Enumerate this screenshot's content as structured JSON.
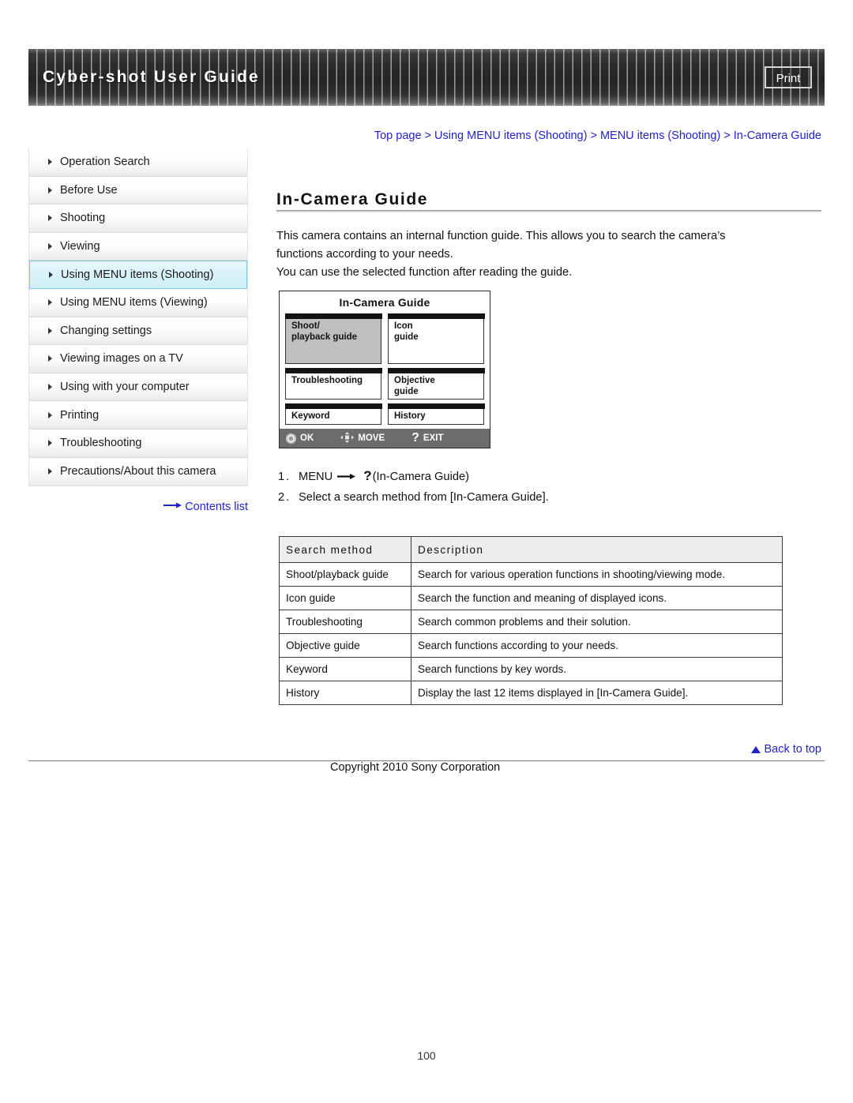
{
  "header": {
    "title": "Cyber-shot User Guide",
    "print_label": "Print"
  },
  "sidebar": {
    "items": [
      {
        "label": "Operation Search",
        "active": false
      },
      {
        "label": "Before Use",
        "active": false
      },
      {
        "label": "Shooting",
        "active": false
      },
      {
        "label": "Viewing",
        "active": false
      },
      {
        "label": "Using MENU items (Shooting)",
        "active": true
      },
      {
        "label": "Using MENU items (Viewing)",
        "active": false
      },
      {
        "label": "Changing settings",
        "active": false
      },
      {
        "label": "Viewing images on a TV",
        "active": false
      },
      {
        "label": "Using with your computer",
        "active": false
      },
      {
        "label": "Printing",
        "active": false
      },
      {
        "label": "Troubleshooting",
        "active": false
      },
      {
        "label": "Precautions/About this camera",
        "active": false
      }
    ],
    "contents_link": "Contents list",
    "contents_arrow_icon": "right-arrow-icon"
  },
  "main": {
    "breadcrumb": "Top page > Using MENU items (Shooting) > MENU items (Shooting) > In-Camera Guide",
    "title": "In-Camera Guide",
    "intro_line1": "This camera contains an internal function guide. This allows you to search the camera’s",
    "intro_line2": "functions according to your needs.",
    "intro_line3": "You can use the selected function after reading the guide.",
    "camera_screen": {
      "title": "In-Camera Guide",
      "cells": [
        {
          "line1": "Shoot/",
          "line2": "playback guide",
          "selected": true
        },
        {
          "line1": "Icon",
          "line2": "guide",
          "selected": false
        },
        {
          "line1": "Troubleshooting",
          "line2": "",
          "selected": false
        },
        {
          "line1": "Objective",
          "line2": "guide",
          "selected": false
        },
        {
          "line1": "Keyword",
          "line2": "",
          "selected": false
        },
        {
          "line1": "History",
          "line2": "",
          "selected": false
        }
      ],
      "bar": {
        "ok_icon": "control-wheel-icon",
        "ok_label": "OK",
        "move_icon": "four-way-arrow-icon",
        "move_label": "MOVE",
        "exit_icon": "question-mark-icon",
        "exit_label": "EXIT"
      }
    },
    "steps": [
      {
        "num": "1.",
        "pre": "MENU",
        "arrow_icon": "right-arrow-icon",
        "qmark": "?",
        "post": "(In-Camera Guide)"
      },
      {
        "num": "2.",
        "pre": "Select a search method from [In-Camera Guide].",
        "arrow_icon": "",
        "qmark": "",
        "post": ""
      }
    ],
    "table": {
      "headers": [
        "Search method",
        "Description"
      ],
      "rows": [
        [
          "Shoot/playback guide",
          "Search for various operation functions in shooting/viewing mode."
        ],
        [
          "Icon guide",
          "Search the function and meaning of displayed icons."
        ],
        [
          "Troubleshooting",
          "Search common problems and their solution."
        ],
        [
          "Objective guide",
          "Search functions according to your needs."
        ],
        [
          "Keyword",
          "Search functions by key words."
        ],
        [
          "History",
          "Display the last 12 items displayed in [In-Camera Guide]."
        ]
      ]
    }
  },
  "footer": {
    "back_to_top": "Back to top",
    "back_to_top_icon": "triangle-up-icon",
    "copyright": "Copyright 2010 Sony Corporation",
    "page_number": "100"
  },
  "colors": {
    "link": "#2222cc",
    "banner_dark": "#2b2b2b",
    "sidebar_active": "#d8f2fa",
    "table_header": "#ededed"
  }
}
